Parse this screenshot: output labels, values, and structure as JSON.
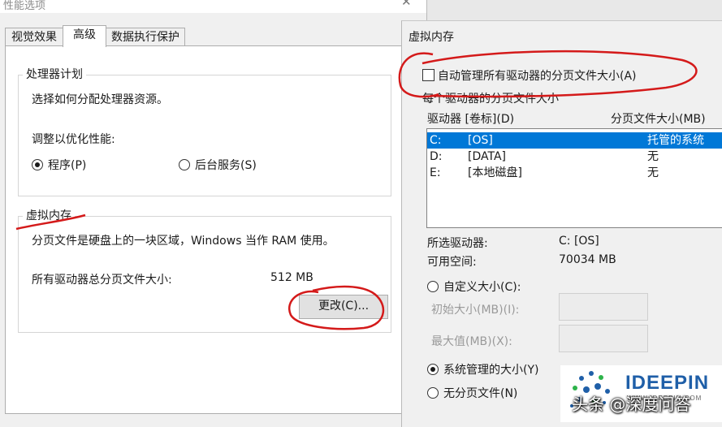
{
  "perf_window": {
    "title": "性能选项",
    "close_glyph": "✕",
    "tabs": [
      "视觉效果",
      "高级",
      "数据执行保护"
    ],
    "processor": {
      "group_title": "处理器计划",
      "description": "选择如何分配处理器资源。",
      "adjust_label": "调整以优化性能:",
      "option_programs": "程序(P)",
      "option_background": "后台服务(S)"
    },
    "virtual_memory": {
      "group_title": "虚拟内存",
      "description": "分页文件是硬盘上的一块区域，Windows 当作 RAM 使用。",
      "total_label": "所有驱动器总分页文件大小:",
      "total_value": "512 MB",
      "change_button": "更改(C)..."
    }
  },
  "vm_window": {
    "title": "虚拟内存",
    "auto_manage_label": "自动管理所有驱动器的分页文件大小(A)",
    "section_label": "每个驱动器的分页文件大小",
    "col_drive": "驱动器 [卷标](D)",
    "col_size": "分页文件大小(MB)",
    "drives": [
      {
        "letter": "C:",
        "label": "[OS]",
        "size": "托管的系统"
      },
      {
        "letter": "D:",
        "label": "[DATA]",
        "size": "无"
      },
      {
        "letter": "E:",
        "label": "[本地磁盘]",
        "size": "无"
      }
    ],
    "selected_drive_label": "所选驱动器:",
    "selected_drive_value": "C:  [OS]",
    "free_space_label": "可用空间:",
    "free_space_value": "70034 MB",
    "custom_size": "自定义大小(C):",
    "initial_size_label": "初始大小(MB)(I):",
    "max_size_label": "最大值(MB)(X):",
    "system_managed": "系统管理的大小(Y)",
    "no_paging": "无分页文件(N)"
  },
  "watermark": {
    "brand": "IDEEPIN",
    "sub": "WWW.IDEEPIN.COM",
    "caption": "头条 @深度问答"
  },
  "colors": {
    "selection": "#0078d7",
    "annotation": "#d41a1a",
    "brand_blue": "#1f5fa8"
  }
}
